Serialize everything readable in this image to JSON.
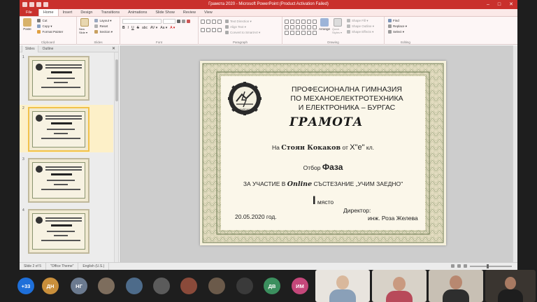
{
  "window": {
    "title": "Грамота 2020  -  Microsoft PowerPoint (Product Activation Failed)",
    "controls": [
      "–",
      "□",
      "✕"
    ]
  },
  "tabs": [
    {
      "label": "File",
      "kind": "file"
    },
    {
      "label": "Home",
      "kind": "active"
    },
    {
      "label": "Insert",
      "kind": "normal"
    },
    {
      "label": "Design",
      "kind": "normal"
    },
    {
      "label": "Transitions",
      "kind": "normal"
    },
    {
      "label": "Animations",
      "kind": "normal"
    },
    {
      "label": "Slide Show",
      "kind": "normal"
    },
    {
      "label": "Review",
      "kind": "normal"
    },
    {
      "label": "View",
      "kind": "normal"
    }
  ],
  "ribbon": {
    "clipboard": {
      "paste": "Paste",
      "cut": "Cut",
      "copy": "Copy ▾",
      "format_painter": "Format Painter",
      "label": "Clipboard"
    },
    "slides": {
      "new_slide": "New Slide ▾",
      "layout": "Layout ▾",
      "reset": "Reset",
      "section": "Section ▾",
      "label": "Slides"
    },
    "font": {
      "label": "Font",
      "glyphs": [
        "B",
        "I",
        "U",
        "S",
        "abc",
        "AV ▾",
        "Aa ▾",
        "A ▾"
      ]
    },
    "paragraph": {
      "text_direction": "Text Direction ▾",
      "align_text": "Align Text ▾",
      "smartart": "Convert to SmartArt ▾",
      "label": "Paragraph"
    },
    "drawing": {
      "arrange": "Arrange",
      "quick_styles": "Quick Styles ▾",
      "shape_fill": "Shape Fill ▾",
      "shape_outline": "Shape Outline ▾",
      "shape_effects": "Shape Effects ▾",
      "label": "Drawing"
    },
    "editing": {
      "find": "Find",
      "replace": "Replace ▾",
      "select": "Select ▾",
      "label": "Editing"
    }
  },
  "pane": {
    "tabs": [
      "Slides",
      "Outline"
    ],
    "close": "✕",
    "thumbs": [
      {
        "num": "1",
        "selected": false
      },
      {
        "num": "2",
        "selected": true
      },
      {
        "num": "3",
        "selected": false
      },
      {
        "num": "4",
        "selected": false
      }
    ]
  },
  "slide": {
    "school": [
      "ПРОФЕСИОНАЛНА ГИМНАЗИЯ",
      "ПО МЕХАНОЕЛЕКТРОТЕХНИКА",
      "И ЕЛЕКТРОНИКА – БУРГАС"
    ],
    "seal_text": "БУРГАС",
    "title": "ГРАМОТА",
    "name_prefix": "На ",
    "name": "Стоян Кокаков",
    "class_prefix": "  от  ",
    "class": "Х\"е\"",
    "class_suffix": " кл.",
    "team_prefix": "Отбор ",
    "team": "Фаза",
    "event_prefix": "ЗА УЧАСТИЕ В ",
    "event_online": "Online",
    "event_suffix": " СЪСТЕЗАНИЕ „УЧИМ ЗАЕДНО\"",
    "place": "I",
    "place_suffix": " място",
    "director": "Директор:",
    "date": "20.05.2020 год.",
    "signer": "инж. Роза Желева"
  },
  "status": {
    "slide": "Slide 2 of 5",
    "theme": "\"Office Theme\"",
    "language": "English (U.S.)"
  },
  "conference": {
    "avatars": [
      {
        "label": "+33",
        "color": "#1e6fd9"
      },
      {
        "label": "ДН",
        "color": "#c98f3b"
      },
      {
        "label": "НГ",
        "color": "#6b7a8f"
      },
      {
        "label": "",
        "color": "#7d6d5d"
      },
      {
        "label": "",
        "color": "#4d6b8a"
      },
      {
        "label": "",
        "color": "#5b5b5b"
      },
      {
        "label": "",
        "color": "#8a4a3a"
      },
      {
        "label": "",
        "color": "#6b5a4a"
      },
      {
        "label": "",
        "color": "#3a3a3a"
      },
      {
        "label": "ДВ",
        "color": "#3b8f5e"
      },
      {
        "label": "ИМ",
        "color": "#c4477a"
      }
    ]
  }
}
